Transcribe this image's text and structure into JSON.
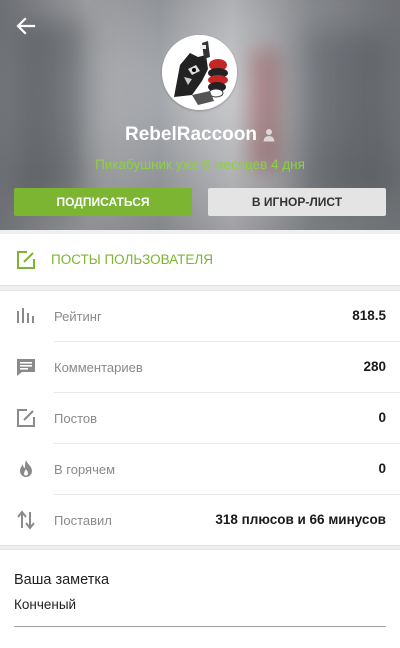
{
  "profile": {
    "username": "RebelRaccoon",
    "since": "Пикабушник уже 6 месяцев 4 дня",
    "subscribe_label": "ПОДПИСАТЬСЯ",
    "ignore_label": "В ИГНОР-ЛИСТ"
  },
  "posts_link": {
    "label": "ПОСТЫ ПОЛЬЗОВАТЕЛЯ"
  },
  "stats": [
    {
      "icon": "bar-chart-icon",
      "label": "Рейтинг",
      "value": "818.5"
    },
    {
      "icon": "comment-icon",
      "label": "Комментариев",
      "value": "280"
    },
    {
      "icon": "edit-icon",
      "label": "Постов",
      "value": "0"
    },
    {
      "icon": "flame-icon",
      "label": "В горячем",
      "value": "0"
    },
    {
      "icon": "sort-arrows-icon",
      "label": "Поставил",
      "value": "318 плюсов и 66 минусов"
    }
  ],
  "note": {
    "title": "Ваша заметка",
    "text": "Конченый"
  },
  "colors": {
    "accent": "#7bb531",
    "since_text": "#8ed140",
    "ignore_bg": "#e4e4e4"
  }
}
